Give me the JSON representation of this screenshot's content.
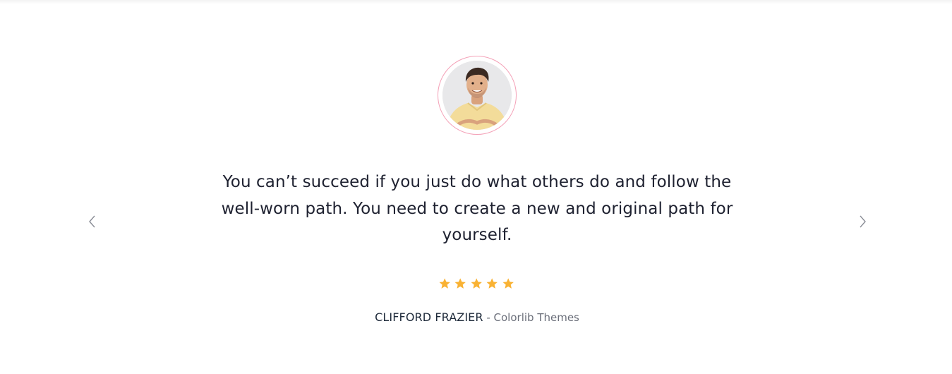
{
  "testimonial": {
    "quote": "You can’t succeed if you just do what others do and follow the well-worn path. You need to create a new and original path for yourself.",
    "rating": 5,
    "rating_max": 5,
    "author_name": "CLIFFORD FRAZIER",
    "separator": " - ",
    "author_company": "Colorlib Themes"
  },
  "navigation": {
    "prev_icon": "chevron-left-icon",
    "next_icon": "chevron-right-icon"
  },
  "colors": {
    "accent_ring": "#f4a2b8",
    "star": "#f9b233",
    "text_dark": "#1e2130",
    "text_muted": "#6b6f7a"
  }
}
